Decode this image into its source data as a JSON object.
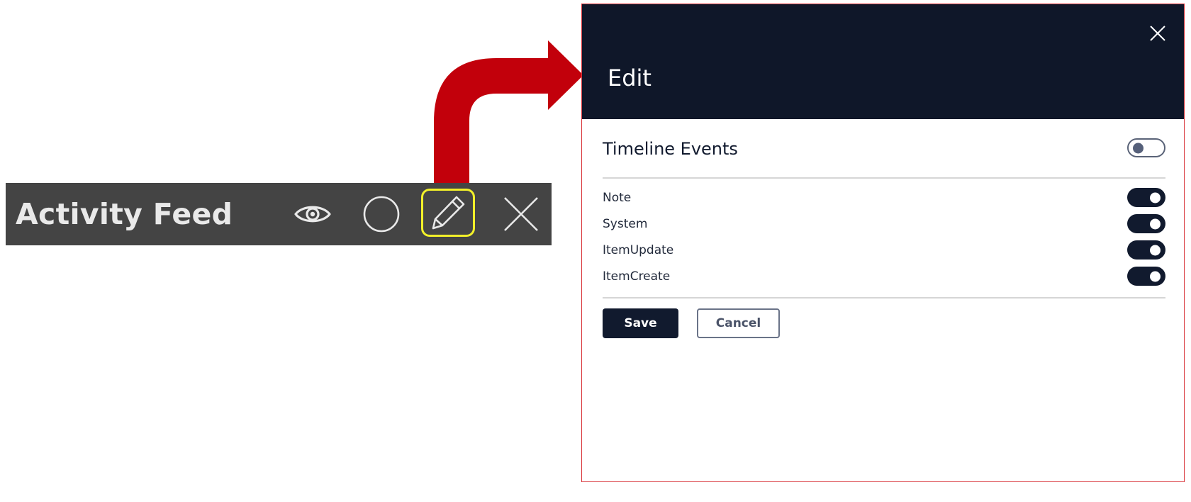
{
  "toolbar": {
    "title": "Activity Feed",
    "icons": [
      "eye-icon",
      "circle-icon",
      "pencil-icon",
      "close-icon"
    ],
    "highlight_color": "#f2f02a",
    "background_color": "#444444"
  },
  "arrow": {
    "color": "#c2000b"
  },
  "edit_panel": {
    "title": "Edit",
    "close_icon": "close-icon",
    "header_color": "#0f1729",
    "section": {
      "title": "Timeline Events",
      "enabled": false
    },
    "events": [
      {
        "label": "Note",
        "enabled": true
      },
      {
        "label": "System",
        "enabled": true
      },
      {
        "label": "ItemUpdate",
        "enabled": true
      },
      {
        "label": "ItemCreate",
        "enabled": true
      }
    ],
    "buttons": {
      "save_label": "Save",
      "cancel_label": "Cancel"
    }
  }
}
